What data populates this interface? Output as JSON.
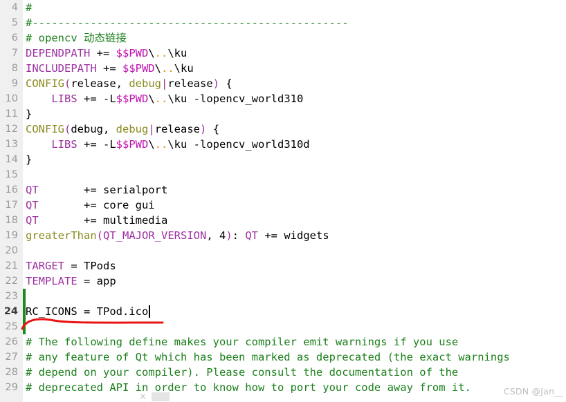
{
  "editor": {
    "language": "qmake-project",
    "gutter_background": "#f0f0f0",
    "background": "#ffffff",
    "change_bar_color": "#1e8a1e",
    "annotation_color": "#e81414",
    "caret_color": "#000000",
    "first_visible_line": 4,
    "last_visible_line": 29,
    "cursor_line": 24,
    "cursor_column": 20
  },
  "colors": {
    "comment": "#1a7f1a",
    "variable": "#9b30a0",
    "function": "#8a8a1f",
    "punctuation": "#9b30a0",
    "plain": "#000000",
    "path_dots": "#e09010",
    "pwd_var": "#c010b0",
    "line_number": "#9a9a9a",
    "line_number_active": "#3b3b3b",
    "watermark": "#bfbfbf"
  },
  "lines": [
    {
      "num": "4",
      "changed": false,
      "current": false,
      "tokens": [
        {
          "t": "#",
          "c": "comment"
        }
      ]
    },
    {
      "num": "5",
      "changed": false,
      "current": false,
      "tokens": [
        {
          "t": "#-------------------------------------------------",
          "c": "comment"
        }
      ]
    },
    {
      "num": "6",
      "changed": false,
      "current": false,
      "tokens": [
        {
          "t": "# opencv 动态链接",
          "c": "comment"
        }
      ]
    },
    {
      "num": "7",
      "changed": false,
      "current": false,
      "tokens": [
        {
          "t": "DEPENDPATH",
          "c": "variable"
        },
        {
          "t": " += ",
          "c": "plain"
        },
        {
          "t": "$$PWD",
          "c": "pwd_var"
        },
        {
          "t": "\\",
          "c": "plain"
        },
        {
          "t": "..",
          "c": "path_dots"
        },
        {
          "t": "\\ku",
          "c": "plain"
        }
      ]
    },
    {
      "num": "8",
      "changed": false,
      "current": false,
      "tokens": [
        {
          "t": "INCLUDEPATH",
          "c": "variable"
        },
        {
          "t": " += ",
          "c": "plain"
        },
        {
          "t": "$$PWD",
          "c": "pwd_var"
        },
        {
          "t": "\\",
          "c": "plain"
        },
        {
          "t": "..",
          "c": "path_dots"
        },
        {
          "t": "\\ku",
          "c": "plain"
        }
      ]
    },
    {
      "num": "9",
      "changed": false,
      "current": false,
      "tokens": [
        {
          "t": "CONFIG",
          "c": "function"
        },
        {
          "t": "(",
          "c": "punctuation"
        },
        {
          "t": "release, ",
          "c": "plain"
        },
        {
          "t": "debug",
          "c": "function"
        },
        {
          "t": "|",
          "c": "punctuation"
        },
        {
          "t": "release",
          "c": "plain"
        },
        {
          "t": ")",
          "c": "punctuation"
        },
        {
          "t": " {",
          "c": "plain"
        }
      ]
    },
    {
      "num": "10",
      "changed": false,
      "current": false,
      "tokens": [
        {
          "t": "    ",
          "c": "plain"
        },
        {
          "t": "LIBS",
          "c": "variable"
        },
        {
          "t": " += -L",
          "c": "plain"
        },
        {
          "t": "$$PWD",
          "c": "pwd_var"
        },
        {
          "t": "\\",
          "c": "plain"
        },
        {
          "t": "..",
          "c": "path_dots"
        },
        {
          "t": "\\ku -lopencv_world310",
          "c": "plain"
        }
      ]
    },
    {
      "num": "11",
      "changed": false,
      "current": false,
      "tokens": [
        {
          "t": "}",
          "c": "plain"
        }
      ]
    },
    {
      "num": "12",
      "changed": false,
      "current": false,
      "tokens": [
        {
          "t": "CONFIG",
          "c": "function"
        },
        {
          "t": "(",
          "c": "punctuation"
        },
        {
          "t": "debug, ",
          "c": "plain"
        },
        {
          "t": "debug",
          "c": "function"
        },
        {
          "t": "|",
          "c": "punctuation"
        },
        {
          "t": "release",
          "c": "plain"
        },
        {
          "t": ")",
          "c": "punctuation"
        },
        {
          "t": " {",
          "c": "plain"
        }
      ]
    },
    {
      "num": "13",
      "changed": false,
      "current": false,
      "tokens": [
        {
          "t": "    ",
          "c": "plain"
        },
        {
          "t": "LIBS",
          "c": "variable"
        },
        {
          "t": " += -L",
          "c": "plain"
        },
        {
          "t": "$$PWD",
          "c": "pwd_var"
        },
        {
          "t": "\\",
          "c": "plain"
        },
        {
          "t": "..",
          "c": "path_dots"
        },
        {
          "t": "\\ku -lopencv_world310d",
          "c": "plain"
        }
      ]
    },
    {
      "num": "14",
      "changed": false,
      "current": false,
      "tokens": [
        {
          "t": "}",
          "c": "plain"
        }
      ]
    },
    {
      "num": "15",
      "changed": false,
      "current": false,
      "tokens": []
    },
    {
      "num": "16",
      "changed": false,
      "current": false,
      "tokens": [
        {
          "t": "QT",
          "c": "variable"
        },
        {
          "t": "       += serialport",
          "c": "plain"
        }
      ]
    },
    {
      "num": "17",
      "changed": false,
      "current": false,
      "tokens": [
        {
          "t": "QT",
          "c": "variable"
        },
        {
          "t": "       += core gui",
          "c": "plain"
        }
      ]
    },
    {
      "num": "18",
      "changed": false,
      "current": false,
      "tokens": [
        {
          "t": "QT",
          "c": "variable"
        },
        {
          "t": "       += multimedia",
          "c": "plain"
        }
      ]
    },
    {
      "num": "19",
      "changed": false,
      "current": false,
      "tokens": [
        {
          "t": "greaterThan",
          "c": "function"
        },
        {
          "t": "(",
          "c": "punctuation"
        },
        {
          "t": "QT_MAJOR_VERSION",
          "c": "variable"
        },
        {
          "t": ", 4",
          "c": "plain"
        },
        {
          "t": ")",
          "c": "punctuation"
        },
        {
          "t": ": ",
          "c": "plain"
        },
        {
          "t": "QT",
          "c": "variable"
        },
        {
          "t": " += widgets",
          "c": "plain"
        }
      ]
    },
    {
      "num": "20",
      "changed": false,
      "current": false,
      "tokens": []
    },
    {
      "num": "21",
      "changed": false,
      "current": false,
      "tokens": [
        {
          "t": "TARGET",
          "c": "variable"
        },
        {
          "t": " = TPods",
          "c": "plain"
        }
      ]
    },
    {
      "num": "22",
      "changed": false,
      "current": false,
      "tokens": [
        {
          "t": "TEMPLATE",
          "c": "variable"
        },
        {
          "t": " = app",
          "c": "plain"
        }
      ]
    },
    {
      "num": "23",
      "changed": true,
      "current": false,
      "tokens": []
    },
    {
      "num": "24",
      "changed": true,
      "current": true,
      "tokens": [
        {
          "t": "RC_ICONS = TPod.ico",
          "c": "plain"
        }
      ]
    },
    {
      "num": "25",
      "changed": true,
      "current": false,
      "tokens": []
    },
    {
      "num": "26",
      "changed": false,
      "current": false,
      "tokens": [
        {
          "t": "# The following define makes your compiler emit warnings if you use",
          "c": "comment"
        }
      ]
    },
    {
      "num": "27",
      "changed": false,
      "current": false,
      "tokens": [
        {
          "t": "# any feature of Qt which has been marked as deprecated (the exact warnings",
          "c": "comment"
        }
      ]
    },
    {
      "num": "28",
      "changed": false,
      "current": false,
      "tokens": [
        {
          "t": "# depend on your compiler). Please consult the documentation of the",
          "c": "comment"
        }
      ]
    },
    {
      "num": "29",
      "changed": false,
      "current": false,
      "tokens": [
        {
          "t": "# deprecated API in order to know how to port your code away from it.",
          "c": "comment"
        }
      ]
    }
  ],
  "bottom_widget": {
    "close_glyph": "×"
  },
  "watermark": {
    "text": "CSDN @Jan__"
  }
}
